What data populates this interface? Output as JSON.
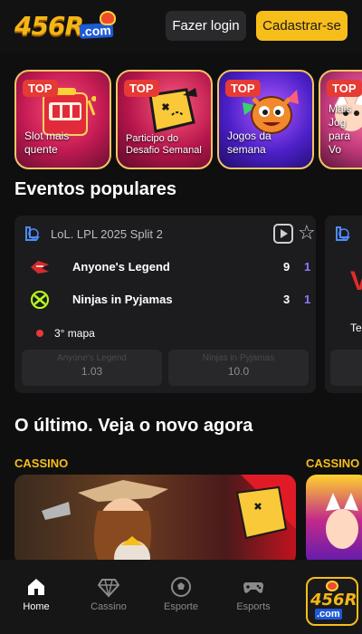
{
  "header": {
    "logo_text": "456R",
    "logo_suffix": ".com",
    "login_label": "Fazer login",
    "signup_label": "Cadastrar-se"
  },
  "promos": [
    {
      "badge": "TOP",
      "label": "Slot mais quente"
    },
    {
      "badge": "TOP",
      "label": "Participo do Desafio Semanal"
    },
    {
      "badge": "TOP",
      "label": "Jogos da semana"
    },
    {
      "badge": "TOP",
      "label": "Mais Jog para Vo"
    }
  ],
  "popular_events": {
    "title": "Eventos populares",
    "event": {
      "league": "LoL. LPL 2025 Split 2",
      "teams": [
        {
          "name": "Anyone's Legend",
          "score": "9",
          "map_score": "1"
        },
        {
          "name": "Ninjas in Pyjamas",
          "score": "3",
          "map_score": "1"
        }
      ],
      "map_label": "3° mapa",
      "odds": [
        {
          "team": "Anyone's Legend",
          "value": "1.03"
        },
        {
          "team": "Ninjas in Pyjamas",
          "value": "10.0"
        }
      ]
    },
    "next_event_partial": {
      "mark": "V",
      "text": "Te"
    }
  },
  "latest": {
    "title": "O último. Veja o novo agora",
    "categories": [
      "CASSINO",
      "CASSINO"
    ]
  },
  "bottom_nav": {
    "items": [
      {
        "label": "Home",
        "icon": "home-icon",
        "active": true
      },
      {
        "label": "Cassino",
        "icon": "diamond-icon",
        "active": false
      },
      {
        "label": "Esporte",
        "icon": "soccer-ball-icon",
        "active": false
      },
      {
        "label": "Esports",
        "icon": "gamepad-icon",
        "active": false
      }
    ],
    "app_badge_text": "456R",
    "app_badge_suffix": ".com"
  },
  "colors": {
    "background": "#0f0f10",
    "accent_yellow": "#f7be1a",
    "top_badge_red": "#e63a35",
    "map_score_purple": "#8c7bff"
  }
}
